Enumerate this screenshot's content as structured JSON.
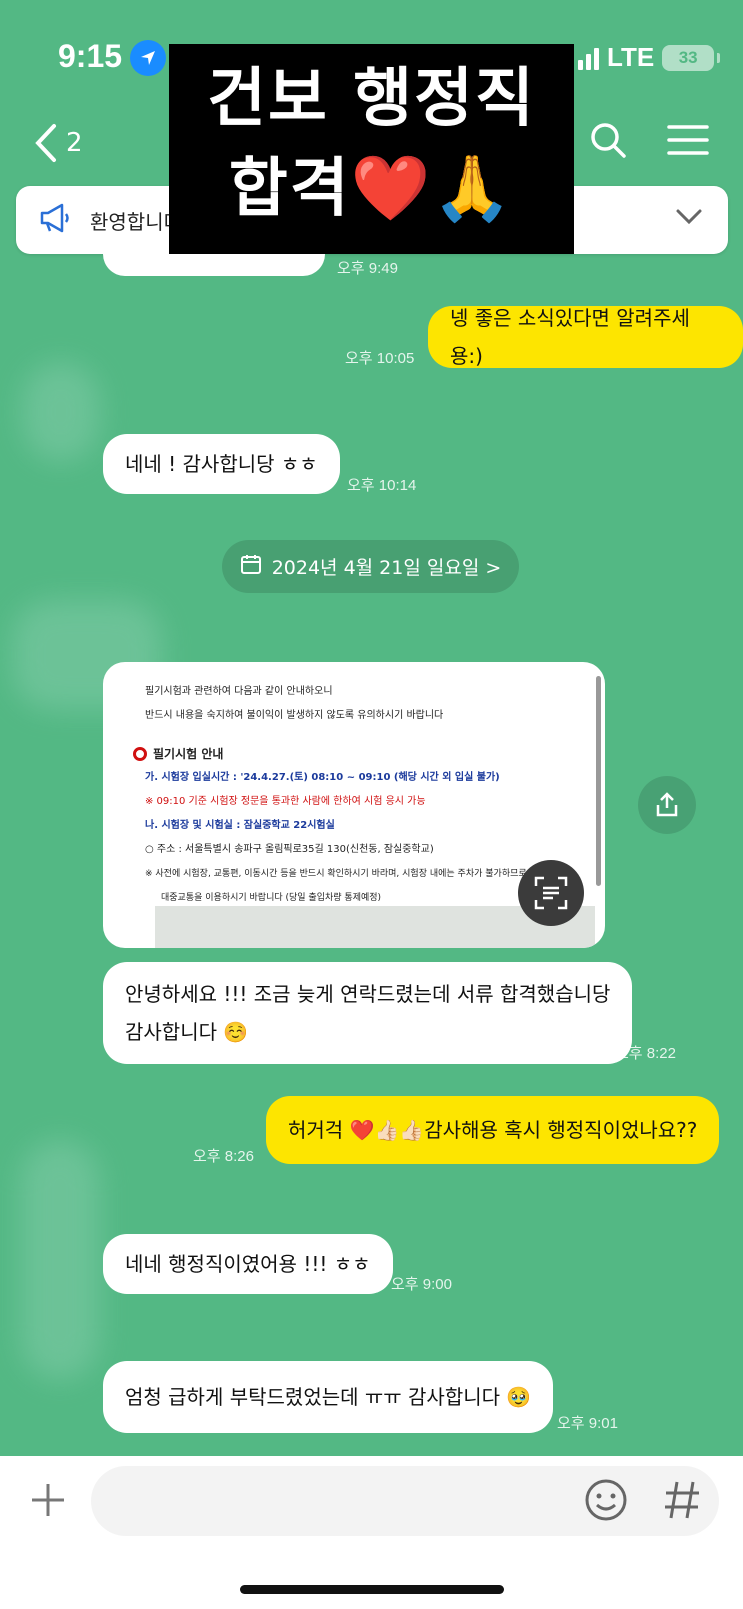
{
  "status_bar": {
    "time": "9:15",
    "network": "LTE",
    "battery": "33"
  },
  "header": {
    "back_label": "<",
    "title_partial": "2"
  },
  "notice": {
    "text": "환영합니다"
  },
  "overlay_caption": {
    "line1": "건보 행정직",
    "line2": "합격❤️🙏"
  },
  "messages": [
    {
      "from": "me",
      "text": "넹 좋은 소식있다면 알려주세용:)",
      "time": "오후 10:05"
    },
    {
      "from": "other",
      "text": "네네 ! 감사합니당 ㅎㅎ",
      "time": "오후 10:14"
    },
    {
      "from": "other",
      "text_line1": "안녕하세요 !!! 조금 늦게 연락드렸는데 서류 합격했습니당",
      "text_line2": "감사합니다 ☺️",
      "time": "오후 8:22"
    },
    {
      "from": "me",
      "text": "허거걱 ❤️👍🏻👍🏻감사해용 혹시 행정직이었나요??",
      "time": "오후 8:26"
    },
    {
      "from": "other",
      "text": "네네 행정직이였어용 !!! ㅎㅎ",
      "time": "오후 9:00"
    },
    {
      "from": "other",
      "text": "엄청 급하게 부탁드렸었는데 ㅠㅠ 감사합니다 🥹",
      "time": "오후 9:01"
    }
  ],
  "earlier_time": "오후 9:49",
  "date_divider": "2024년 4월 21일 일요일 >",
  "image_message": {
    "line1": "필기시험과 관련하여 다음과 같이 안내하오니",
    "line2": "반드시 내용을 숙지하여 불이익이 발생하지 않도록 유의하시기 바랍니다",
    "section_title": "필기시험 안내",
    "item_a": "가. 시험장 입실시간 : '24.4.27.(토) 08:10 ~ 09:10 (해당 시간 외 입실 불가)",
    "item_a_note": "※ 09:10 기준 시험장 정문을 통과한 사람에 한하여 시험 응시 가능",
    "item_b": "나. 시험장 및 시험실 : 잠실중학교 22시험실",
    "address": "○ 주소 : 서울특별시 송파구 올림픽로35길 130(신천동, 잠실중학교)",
    "note1": "※ 사전에 시험장, 교통편, 이동시간 등을 반드시 확인하시기 바라며, 시험장 내에는 주차가 불가하므로",
    "note2": "대중교통을 이용하시기 바랍니다 (당일 출입차량 통제예정)"
  },
  "composer": {
    "placeholder": ""
  },
  "colors": {
    "chat_bg": "#53b884",
    "my_bubble": "#fde500",
    "other_bubble": "#ffffff"
  }
}
